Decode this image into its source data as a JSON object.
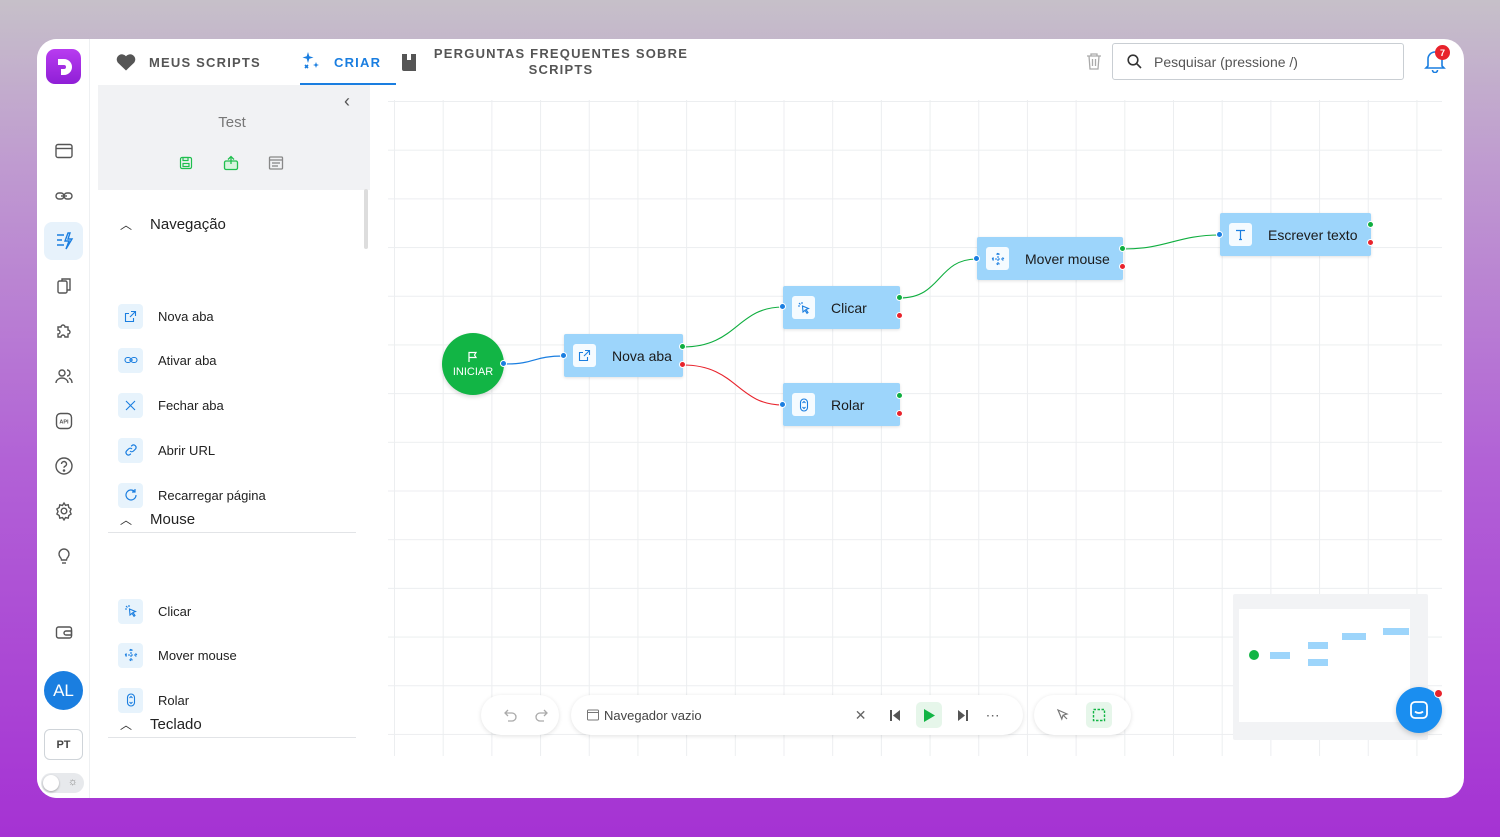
{
  "nav": {
    "tabs": [
      {
        "label": "MEUS SCRIPTS",
        "icon": "heart-icon"
      },
      {
        "label": "CRIAR",
        "icon": "sparkles-icon"
      },
      {
        "label": "PERGUNTAS FREQUENTES SOBRE SCRIPTS",
        "icon": "book-icon"
      }
    ],
    "active_tab": "CRIAR",
    "search_placeholder": "Pesquisar (pressione /)",
    "notification_count": "7"
  },
  "rail": {
    "items": [
      "window-icon",
      "link-icon",
      "scripts-icon",
      "copy-icon",
      "puzzle-icon",
      "users-icon",
      "api-icon",
      "help-icon",
      "settings-icon",
      "bulb-icon",
      "wallet-icon"
    ],
    "active_item": "scripts-icon",
    "avatar_initials": "AL",
    "language": "PT"
  },
  "panel": {
    "script_name": "Test",
    "sections": [
      {
        "title": "Navegação",
        "items": [
          {
            "label": "Nova aba",
            "icon": "new-tab-icon"
          },
          {
            "label": "Ativar aba",
            "icon": "link-icon"
          },
          {
            "label": "Fechar aba",
            "icon": "close-icon"
          },
          {
            "label": "Abrir URL",
            "icon": "url-link-icon"
          },
          {
            "label": "Recarregar página",
            "icon": "reload-icon"
          }
        ]
      },
      {
        "title": "Mouse",
        "items": [
          {
            "label": "Clicar",
            "icon": "click-icon"
          },
          {
            "label": "Mover mouse",
            "icon": "move-icon"
          },
          {
            "label": "Rolar",
            "icon": "scroll-icon"
          }
        ]
      },
      {
        "title": "Teclado",
        "items": []
      }
    ]
  },
  "canvas": {
    "start_label": "INICIAR",
    "nodes": [
      {
        "id": "nova-aba",
        "label": "Nova aba",
        "icon": "new-tab-icon"
      },
      {
        "id": "clicar",
        "label": "Clicar",
        "icon": "click-icon"
      },
      {
        "id": "rolar",
        "label": "Rolar",
        "icon": "scroll-icon"
      },
      {
        "id": "mover-mouse",
        "label": "Mover mouse",
        "icon": "move-icon"
      },
      {
        "id": "escrever-texto",
        "label": "Escrever texto",
        "icon": "text-icon"
      }
    ],
    "edges": [
      {
        "from": "iniciar",
        "to": "nova-aba",
        "type": "default"
      },
      {
        "from": "nova-aba",
        "to": "clicar",
        "type": "success"
      },
      {
        "from": "nova-aba",
        "to": "rolar",
        "type": "error"
      },
      {
        "from": "clicar",
        "to": "mover-mouse",
        "type": "success"
      },
      {
        "from": "mover-mouse",
        "to": "escrever-texto",
        "type": "success"
      }
    ]
  },
  "toolbar": {
    "browser_label": "Navegador vazio"
  },
  "colors": {
    "accent": "#1a7ee0",
    "node": "#9dd5fb",
    "start": "#12b545",
    "success": "#0fae3f",
    "error": "#e8232c"
  }
}
